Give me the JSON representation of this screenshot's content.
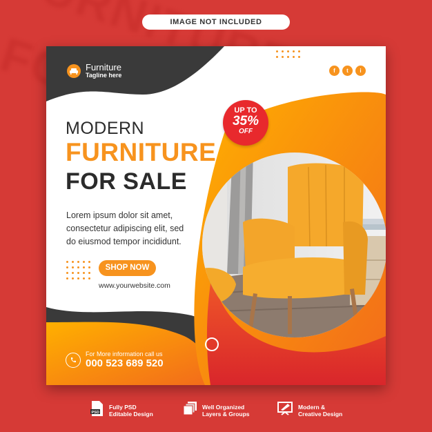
{
  "banner": {
    "label": "IMAGE NOT INCLUDED"
  },
  "background": {
    "word1": "FURNITURE",
    "word2": "FOR"
  },
  "poster": {
    "brand": {
      "name": "Furniture",
      "tagline": "Tagline here"
    },
    "social": [
      "f",
      "t",
      "i"
    ],
    "headline": {
      "line1": "MODERN",
      "line2": "FURNITURE",
      "line3": "FOR SALE"
    },
    "description": {
      "line1": "Lorem ipsum dolor sit amet,",
      "line2": "consectetur adipiscing elit, sed",
      "line3": "do eiusmod tempor incididunt."
    },
    "cta": "SHOP NOW",
    "website": "www.yourwebsite.com",
    "badge": {
      "upto": "UP TO",
      "percent": "35%",
      "off": "OFF"
    },
    "contact": {
      "label": "For More information call us",
      "phone": "000 523 689 520"
    }
  },
  "footer": {
    "items": [
      {
        "line1": "Fully PSD",
        "line2": "Editable Design",
        "icon": "psd-file-icon"
      },
      {
        "line1": "Well Organized",
        "line2": "Layers & Groups",
        "icon": "layers-icon"
      },
      {
        "line1": "Modern &",
        "line2": "Creative Design",
        "icon": "design-tools-icon"
      }
    ]
  },
  "colors": {
    "accent": "#f7931e",
    "dark": "#3a3a3a",
    "red": "#e8292d",
    "background": "#d63a36"
  }
}
